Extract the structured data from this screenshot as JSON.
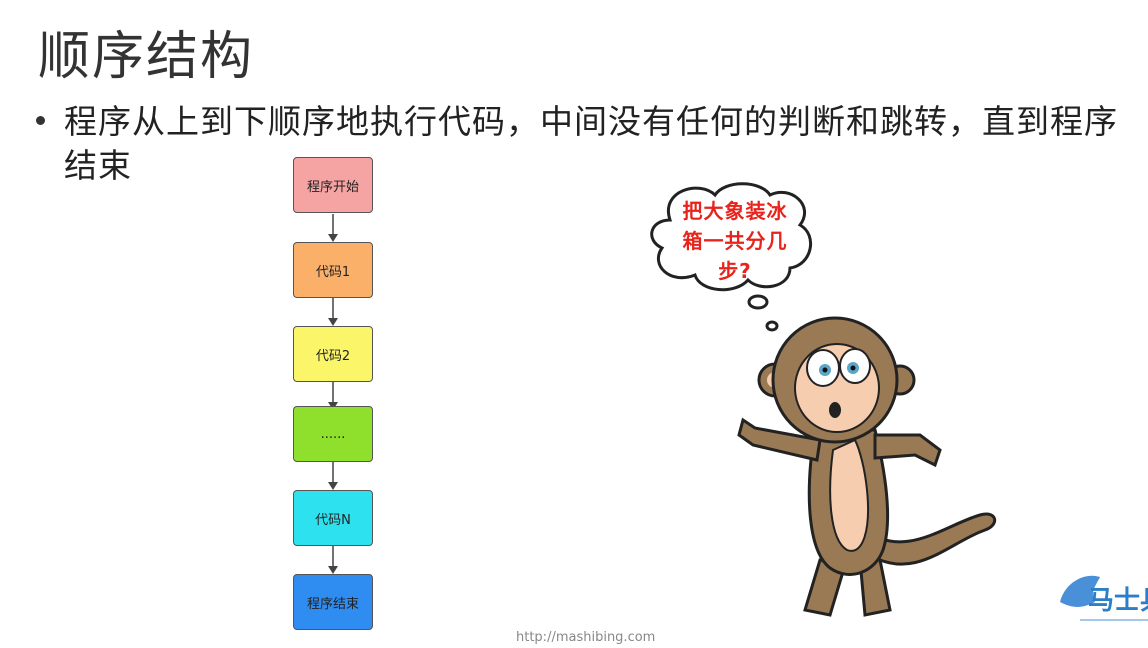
{
  "slide": {
    "title": "顺序结构",
    "bullet": "程序从上到下顺序地执行代码，中间没有任何的判断和跳转，直到程序结束"
  },
  "flowchart": {
    "steps": [
      {
        "label": "程序开始",
        "color": "#f5a3a3"
      },
      {
        "label": "代码1",
        "color": "#fbb06a"
      },
      {
        "label": "代码2",
        "color": "#fbf56a"
      },
      {
        "label": "......",
        "color": "#8ee02c"
      },
      {
        "label": "代码N",
        "color": "#2de2ee"
      },
      {
        "label": "程序结束",
        "color": "#2f8cf0"
      }
    ]
  },
  "thought_bubble": {
    "text": "把大象装冰箱一共分几步?",
    "color": "#e8231c"
  },
  "footer": {
    "url": "http://mashibing.com",
    "logo_text": "马士兵"
  }
}
